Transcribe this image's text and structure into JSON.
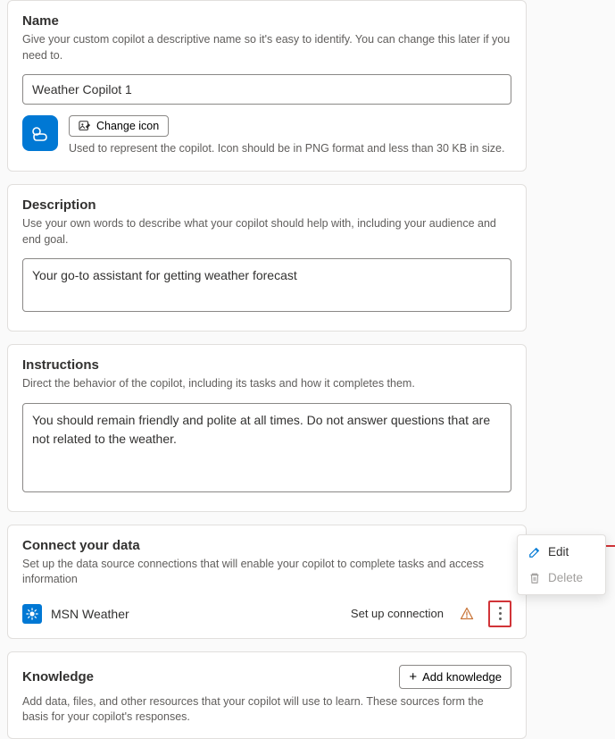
{
  "name_section": {
    "title": "Name",
    "desc": "Give your custom copilot a descriptive name so it's easy to identify. You can change this later if you need to.",
    "value": "Weather Copilot 1",
    "change_icon_label": "Change icon",
    "icon_hint": "Used to represent the copilot. Icon should be in PNG format and less than 30 KB in size."
  },
  "description_section": {
    "title": "Description",
    "desc": "Use your own words to describe what your copilot should help with, including your audience and end goal.",
    "value": "Your go-to assistant for getting weather forecast"
  },
  "instructions_section": {
    "title": "Instructions",
    "desc": "Direct the behavior of the copilot, including its tasks and how it completes them.",
    "value": "You should remain friendly and polite at all times. Do not answer questions that are not related to the weather."
  },
  "connect_section": {
    "title": "Connect your data",
    "desc": "Set up the data source connections that will enable your copilot to complete tasks and access information",
    "item_label": "MSN Weather",
    "setup_label": "Set up connection"
  },
  "knowledge_section": {
    "title": "Knowledge",
    "add_label": "Add knowledge",
    "desc": "Add data, files, and other resources that your copilot will use to learn. These sources form the basis for your copilot's responses."
  },
  "context_menu": {
    "edit": "Edit",
    "delete": "Delete"
  }
}
